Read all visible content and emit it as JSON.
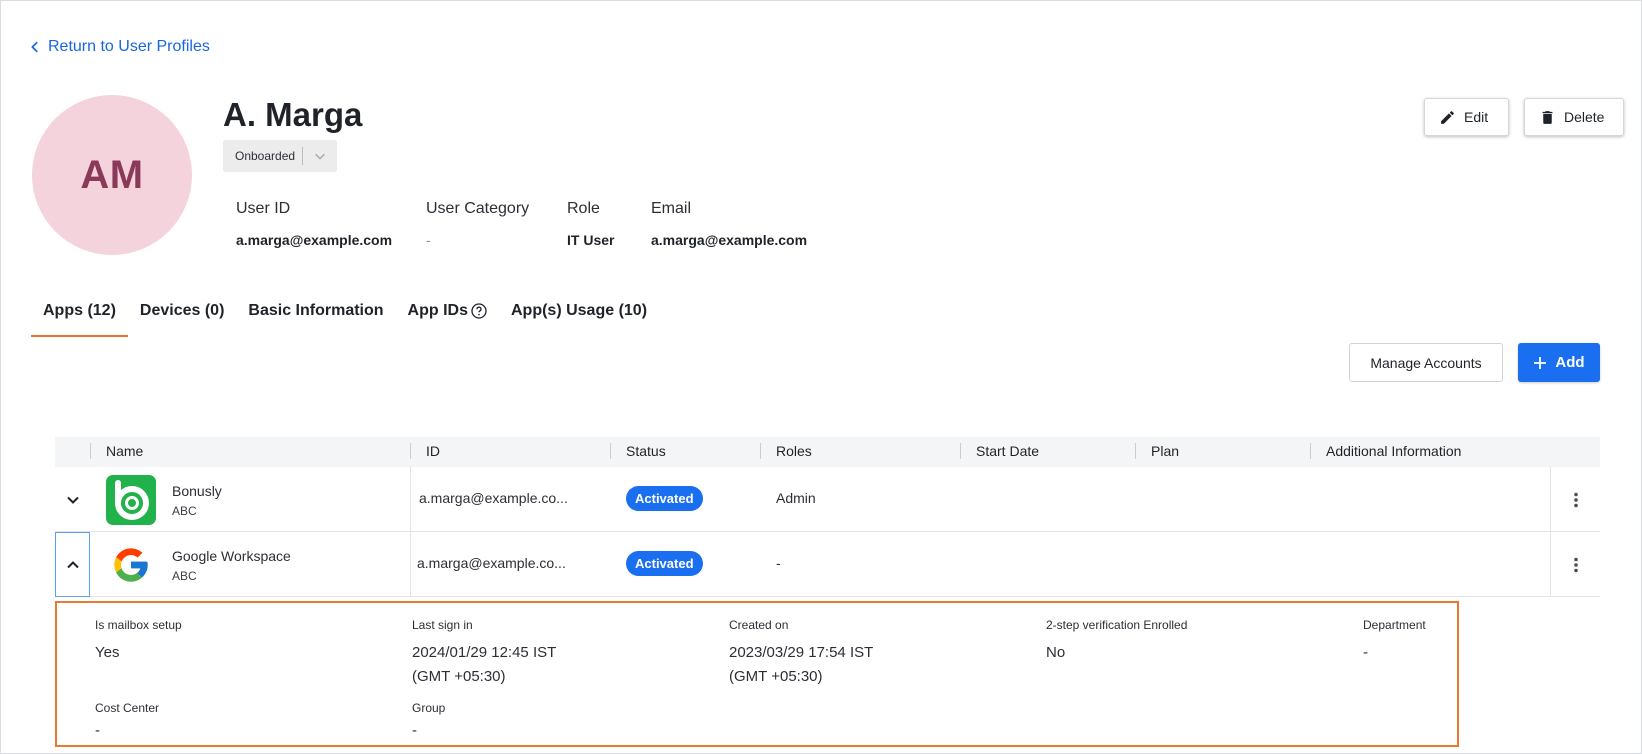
{
  "nav": {
    "back_label": "Return to User Profiles"
  },
  "profile": {
    "initials": "AM",
    "name": "A. Marga",
    "status": "Onboarded",
    "fields": [
      {
        "label": "User ID",
        "value": "a.marga@example.com"
      },
      {
        "label": "User Category",
        "value": "-"
      },
      {
        "label": "Role",
        "value": "IT User"
      },
      {
        "label": "Email",
        "value": "a.marga@example.com"
      }
    ]
  },
  "actions": {
    "edit_label": "Edit",
    "delete_label": "Delete"
  },
  "tabs": [
    {
      "label": "Apps (12)",
      "active": true
    },
    {
      "label": "Devices (0)"
    },
    {
      "label": "Basic Information"
    },
    {
      "label": "App IDs",
      "has_help_icon": true
    },
    {
      "label": "App(s) Usage (10)"
    }
  ],
  "toolbar": {
    "manage_label": "Manage Accounts",
    "add_label": "Add"
  },
  "table": {
    "columns": [
      "Name",
      "ID",
      "Status",
      "Roles",
      "Start Date",
      "Plan",
      "Additional Information"
    ],
    "rows": [
      {
        "name": "Bonusly",
        "sub": "ABC",
        "id": "a.marga@example.co...",
        "status": "Activated",
        "roles": "Admin",
        "logo": "bonusly-logo",
        "expanded": false
      },
      {
        "name": "Google Workspace",
        "sub": "ABC",
        "id": "a.marga@example.co...",
        "status": "Activated",
        "roles": "-",
        "logo": "google-logo",
        "expanded": true
      }
    ]
  },
  "details": {
    "items": [
      {
        "label": "Is mailbox setup",
        "value": "Yes"
      },
      {
        "label": "Last sign in",
        "value_line1": "2024/01/29 12:45 IST",
        "value_line2": "(GMT +05:30)"
      },
      {
        "label": "Created on",
        "value_line1": "2023/03/29 17:54 IST",
        "value_line2": "(GMT +05:30)"
      },
      {
        "label": "2-step verification Enrolled",
        "value": "No"
      },
      {
        "label": "Department",
        "value": "-"
      },
      {
        "label": "Cost Center",
        "value": "-"
      },
      {
        "label": "Group",
        "value": "-"
      }
    ]
  },
  "colors": {
    "accent_blue": "#1a6ff0",
    "tab_underline": "#e8762d",
    "detail_border": "#ea7a2f",
    "avatar_bg": "#f4d3dd",
    "avatar_text": "#8a3a58",
    "bonusly_green": "#21b24b"
  }
}
